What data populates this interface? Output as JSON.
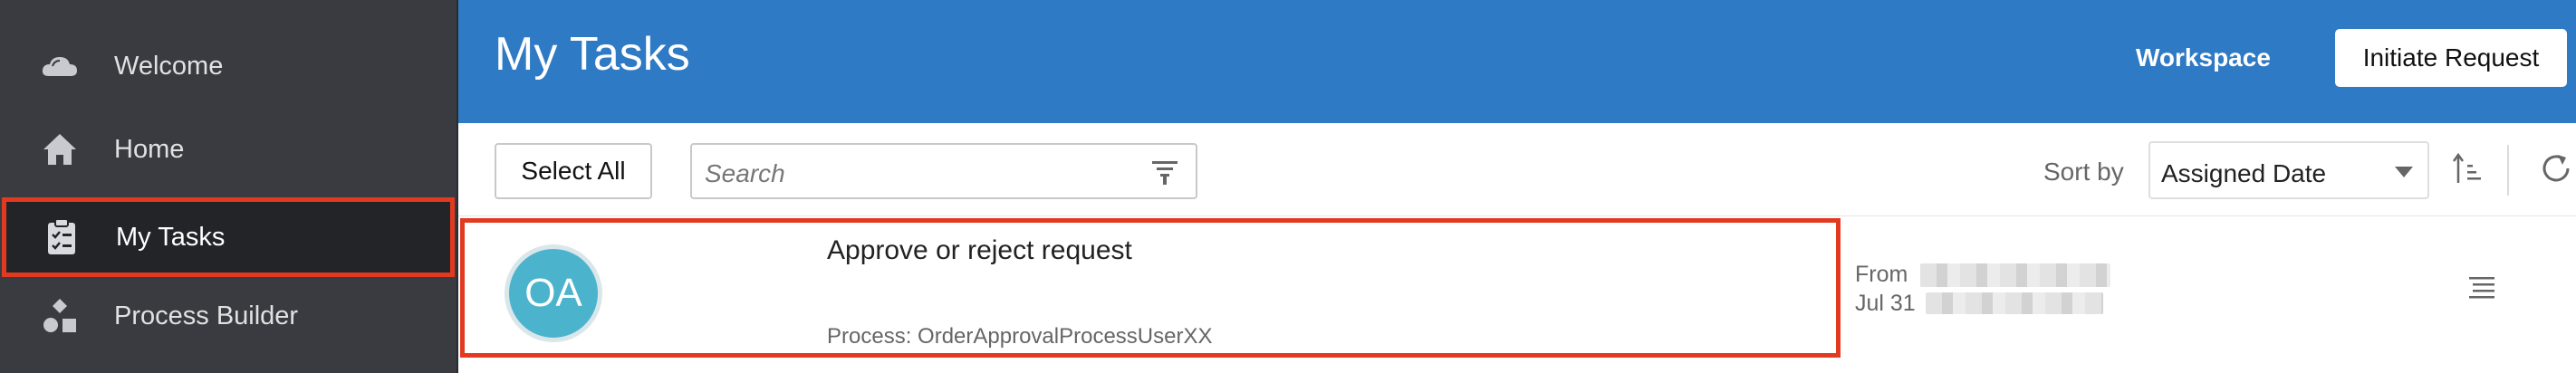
{
  "sidebar": {
    "items": [
      {
        "label": "Welcome",
        "icon": "cloud-icon"
      },
      {
        "label": "Home",
        "icon": "home-icon"
      },
      {
        "label": "My Tasks",
        "icon": "clipboard-check-icon",
        "active": true
      },
      {
        "label": "Process Builder",
        "icon": "shapes-icon"
      }
    ]
  },
  "header": {
    "title": "My Tasks",
    "workspace_label": "Workspace",
    "initiate_label": "Initiate Request"
  },
  "toolbar": {
    "select_all_label": "Select All",
    "search_placeholder": "Search",
    "sort_by_label": "Sort by",
    "sort_value": "Assigned Date"
  },
  "tasks": [
    {
      "avatar_initials": "OA",
      "title": "Approve or reject request",
      "process": "Process: OrderApprovalProcessUserXX",
      "from_label": "From",
      "date": "Jul 31"
    }
  ],
  "colors": {
    "header_bg": "#2f7ac4",
    "sidebar_bg": "#3a3b40",
    "highlight": "#e23a21",
    "avatar_bg": "#4cb3cd"
  }
}
